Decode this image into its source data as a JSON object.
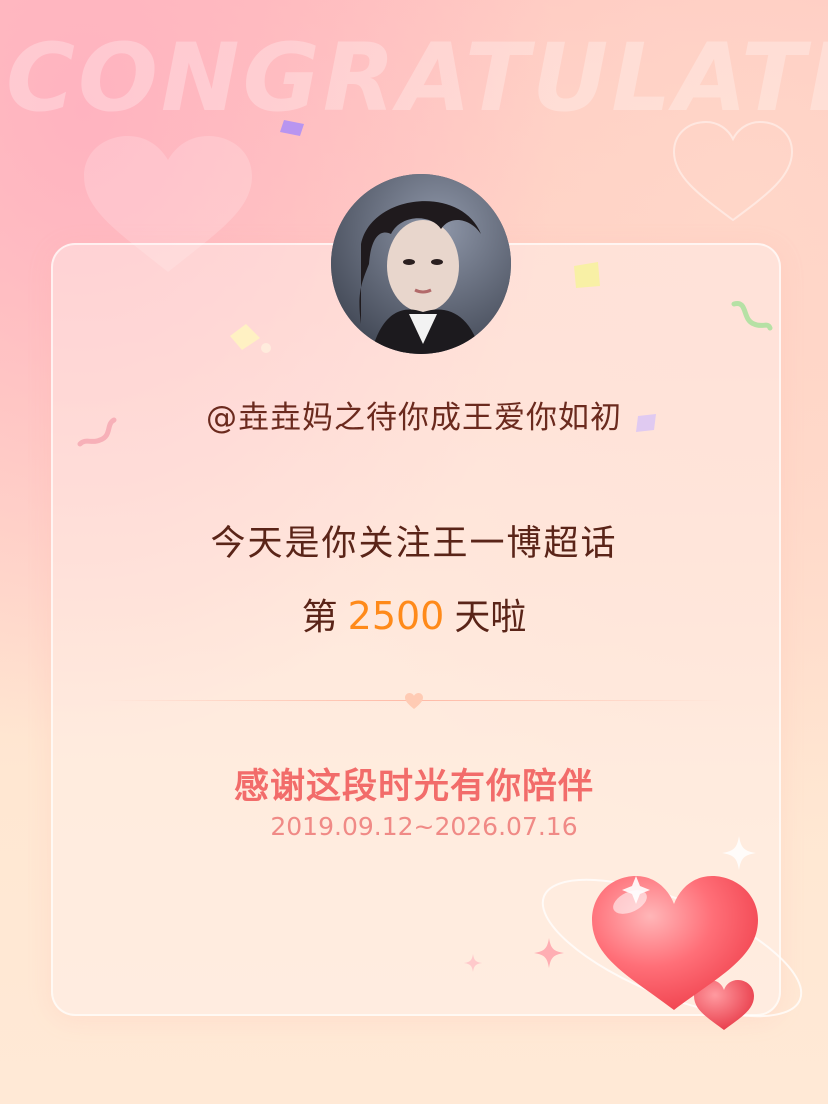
{
  "watermark": "CONGRATULATE",
  "profile": {
    "avatar_alt": "avatar",
    "username": "@垚垚妈之待你成王爱你如初"
  },
  "message": {
    "line1": "今天是你关注王一博超话",
    "line2_prefix": "第",
    "days": "2500",
    "line2_suffix": "天啦"
  },
  "footer": {
    "thanks": "感谢这段时光有你陪伴",
    "date_range": "2019.09.12~2026.07.16"
  },
  "colors": {
    "accent_number": "#ff8a1a",
    "thanks_text": "#f26c6a",
    "primary_text": "#5a2418"
  }
}
